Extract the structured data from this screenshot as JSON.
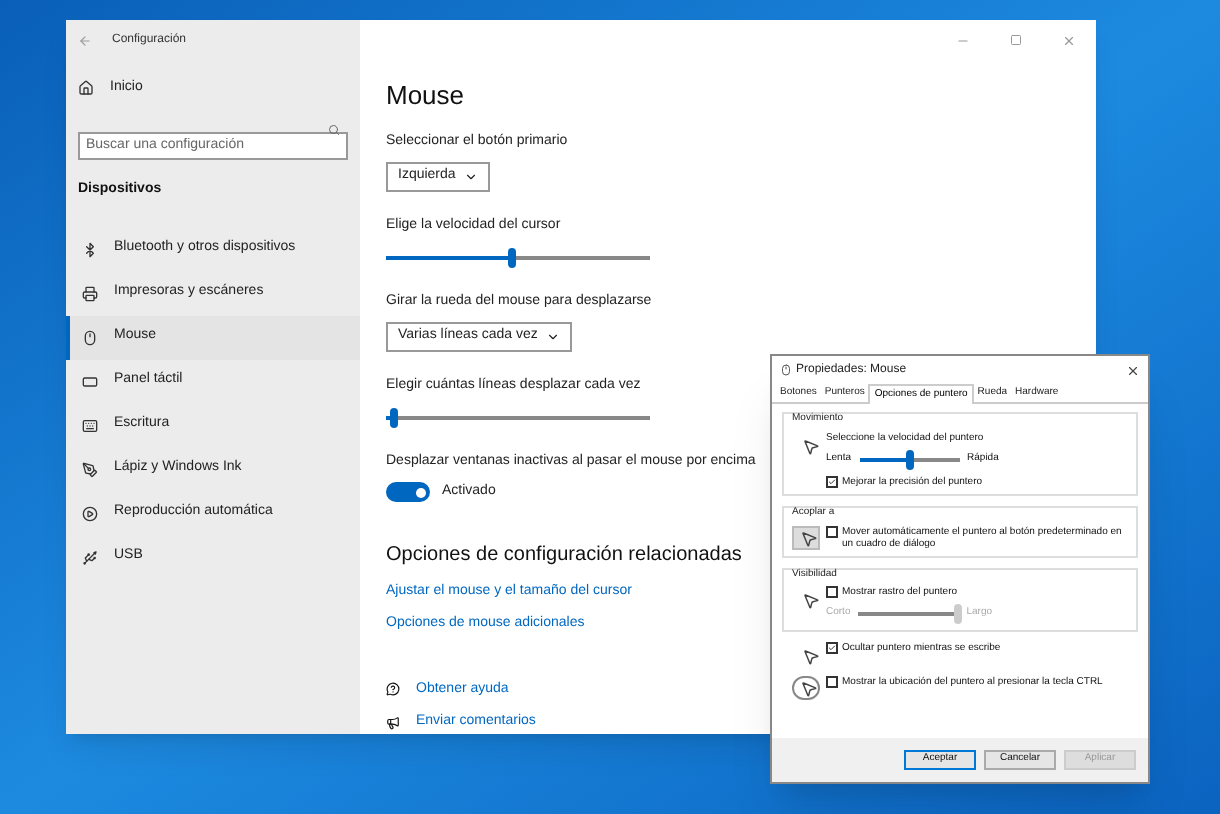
{
  "window": {
    "title": "Configuración"
  },
  "sidebar": {
    "home": "Inicio",
    "search": {
      "placeholder": "Buscar una configuración"
    },
    "section": "Dispositivos",
    "items": [
      {
        "label": "Bluetooth y otros dispositivos",
        "selected": false
      },
      {
        "label": "Impresoras y escáneres",
        "selected": false
      },
      {
        "label": "Mouse",
        "selected": true
      },
      {
        "label": "Panel táctil",
        "selected": false
      },
      {
        "label": "Escritura",
        "selected": false
      },
      {
        "label": "Lápiz y Windows Ink",
        "selected": false
      },
      {
        "label": "Reproducción automática",
        "selected": false
      },
      {
        "label": "USB",
        "selected": false
      }
    ]
  },
  "main": {
    "title": "Mouse",
    "settings": [
      {
        "kind": "dropdown",
        "label": "Seleccionar el botón primario",
        "value": "Izquierda"
      },
      {
        "kind": "slider",
        "label": "Elige la velocidad del cursor",
        "level": 0.48
      },
      {
        "kind": "dropdown",
        "label": "Girar la rueda del mouse para desplazarse",
        "value": "Varias líneas cada vez"
      },
      {
        "kind": "slider",
        "label": "Elegir cuántas líneas desplazar cada vez",
        "level": 0.03
      },
      {
        "kind": "toggle",
        "label": "Desplazar ventanas inactivas al pasar el mouse por encima",
        "on": true,
        "state_text": "Activado"
      }
    ],
    "related": {
      "title": "Opciones de configuración relacionadas",
      "links": [
        "Ajustar el mouse y el tamaño del cursor",
        "Opciones de mouse adicionales"
      ]
    },
    "help": [
      "Obtener ayuda",
      "Enviar comentarios"
    ]
  },
  "dialog": {
    "title": "Propiedades: Mouse",
    "tabs": [
      {
        "label": "Botones",
        "selected": false
      },
      {
        "label": "Punteros",
        "selected": false
      },
      {
        "label": "Opciones de puntero",
        "selected": true
      },
      {
        "label": "Rueda",
        "selected": false
      },
      {
        "label": "Hardware",
        "selected": false
      }
    ],
    "groups": [
      {
        "title": "Movimiento",
        "rows": [
          {
            "kind": "slider",
            "label": "Seleccione la velocidad del puntero",
            "min_label": "Lenta",
            "max_label": "Rápida",
            "level": 0.5
          },
          {
            "kind": "checkbox",
            "label": "Mejorar la precisión del puntero",
            "checked": true
          }
        ]
      },
      {
        "title": "Acoplar a",
        "rows": [
          {
            "kind": "checkbox",
            "label": "Mover automáticamente el puntero al botón predeterminado en un cuadro de diálogo",
            "checked": false
          }
        ]
      },
      {
        "title": "Visibilidad",
        "rows": [
          {
            "kind": "checkbox",
            "label": "Mostrar rastro del puntero",
            "checked": false
          },
          {
            "kind": "slider",
            "min_label": "Corto",
            "max_label": "Largo",
            "level": 1,
            "disabled": true
          }
        ]
      },
      {
        "rows": [
          {
            "kind": "checkbox",
            "label": "Ocultar puntero mientras se escribe",
            "checked": true
          }
        ]
      },
      {
        "rows": [
          {
            "kind": "checkbox",
            "label": "Mostrar la ubicación del puntero al presionar la tecla CTRL",
            "checked": false
          }
        ]
      }
    ],
    "buttons": [
      {
        "label": "Aceptar",
        "disabled": false,
        "default": true
      },
      {
        "label": "Cancelar",
        "disabled": false,
        "default": false
      },
      {
        "label": "Aplicar",
        "disabled": true,
        "default": false
      }
    ]
  }
}
